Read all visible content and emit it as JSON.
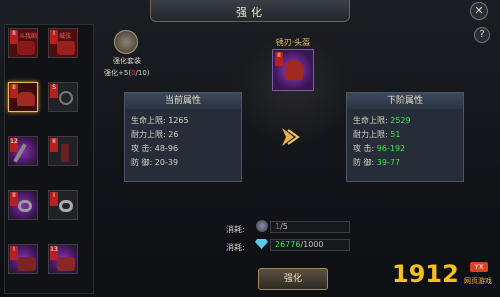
{
  "window": {
    "title": "强化",
    "close_symbol": "✕",
    "help_symbol": "?"
  },
  "suit": {
    "label": "强化套装",
    "progress_prefix": "强化+5(",
    "progress_current": "0",
    "progress_suffix": "/10)"
  },
  "slots": [
    {
      "tag": "II",
      "tag2": "阶",
      "badge": "斗我剧"
    },
    {
      "tag": "I",
      "tag2": "阶",
      "badge": "城弦"
    },
    {
      "tag": "II",
      "tag2": "阶"
    },
    {
      "tag": "S",
      "tag2": "阶"
    },
    {
      "tag": "12",
      "tag2": "阶"
    },
    {
      "tag": "II",
      "tag2": "阶"
    },
    {
      "tag": "II",
      "tag2": "阶"
    },
    {
      "tag": "I",
      "tag2": "阶"
    },
    {
      "tag": "I",
      "tag2": "阶"
    },
    {
      "tag": "13",
      "tag2": "阶"
    },
    {
      "tag": "13",
      "tag2": "阶"
    },
    {
      "tag": "I",
      "tag2": "阶"
    }
  ],
  "center_item": {
    "name": "锈刃·头盔",
    "tag": "II",
    "tag2": "阶"
  },
  "current": {
    "header": "当前属性",
    "rows": [
      {
        "label": "生命上限:",
        "value": "1265"
      },
      {
        "label": "耐力上限:",
        "value": "26"
      },
      {
        "label": "攻      击:",
        "value": "48-96"
      },
      {
        "label": "防      御:",
        "value": "20-39"
      }
    ]
  },
  "next": {
    "header": "下阶属性",
    "rows": [
      {
        "label": "生命上限:",
        "value": "2529"
      },
      {
        "label": "耐力上限:",
        "value": "51"
      },
      {
        "label": "攻      击:",
        "value": "96-192"
      },
      {
        "label": "防      御:",
        "value": "39-77"
      }
    ]
  },
  "cost": [
    {
      "label": "消耗:",
      "current": "1",
      "rest": "/5"
    },
    {
      "label": "消耗:",
      "current": "26776",
      "rest": "/1000"
    }
  ],
  "enhance_button": "强化",
  "watermark": {
    "number": "1912",
    "badge": "YX",
    "site": "网页游戏"
  }
}
